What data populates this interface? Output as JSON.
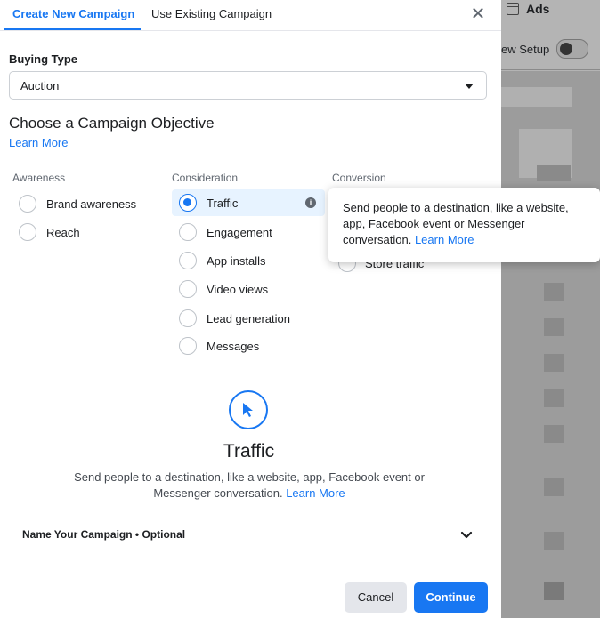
{
  "tabs": [
    {
      "label": "Create New Campaign",
      "active": true
    },
    {
      "label": "Use Existing Campaign",
      "active": false
    }
  ],
  "close_icon": "close-icon",
  "buying_type": {
    "label": "Buying Type",
    "value": "Auction"
  },
  "objective": {
    "title": "Choose a Campaign Objective",
    "learn_more": "Learn More",
    "columns": {
      "awareness": {
        "heading": "Awareness",
        "options": [
          {
            "label": "Brand awareness",
            "selected": false
          },
          {
            "label": "Reach",
            "selected": false
          }
        ]
      },
      "consideration": {
        "heading": "Consideration",
        "options": [
          {
            "label": "Traffic",
            "selected": true
          },
          {
            "label": "Engagement",
            "selected": false
          },
          {
            "label": "App installs",
            "selected": false
          },
          {
            "label": "Video views",
            "selected": false
          },
          {
            "label": "Lead generation",
            "selected": false
          },
          {
            "label": "Messages",
            "selected": false
          }
        ]
      },
      "conversion": {
        "heading": "Conversion",
        "partially_visible_option": "Store traffic"
      }
    }
  },
  "tooltip": {
    "text": "Send people to a destination, like a website, app, Facebook event or Messenger conversation.",
    "link": "Learn More"
  },
  "selected_detail": {
    "icon": "cursor-icon",
    "title": "Traffic",
    "description": "Send people to a destination, like a website, app, Facebook event or Messenger conversation.",
    "link": "Learn More"
  },
  "name_campaign": {
    "label": "Name Your Campaign • Optional"
  },
  "footer": {
    "cancel": "Cancel",
    "continue": "Continue"
  },
  "background": {
    "title": "Ads",
    "setup_label": "ew Setup"
  },
  "colors": {
    "accent": "#1877f2",
    "selected_bg": "#e7f3ff"
  }
}
